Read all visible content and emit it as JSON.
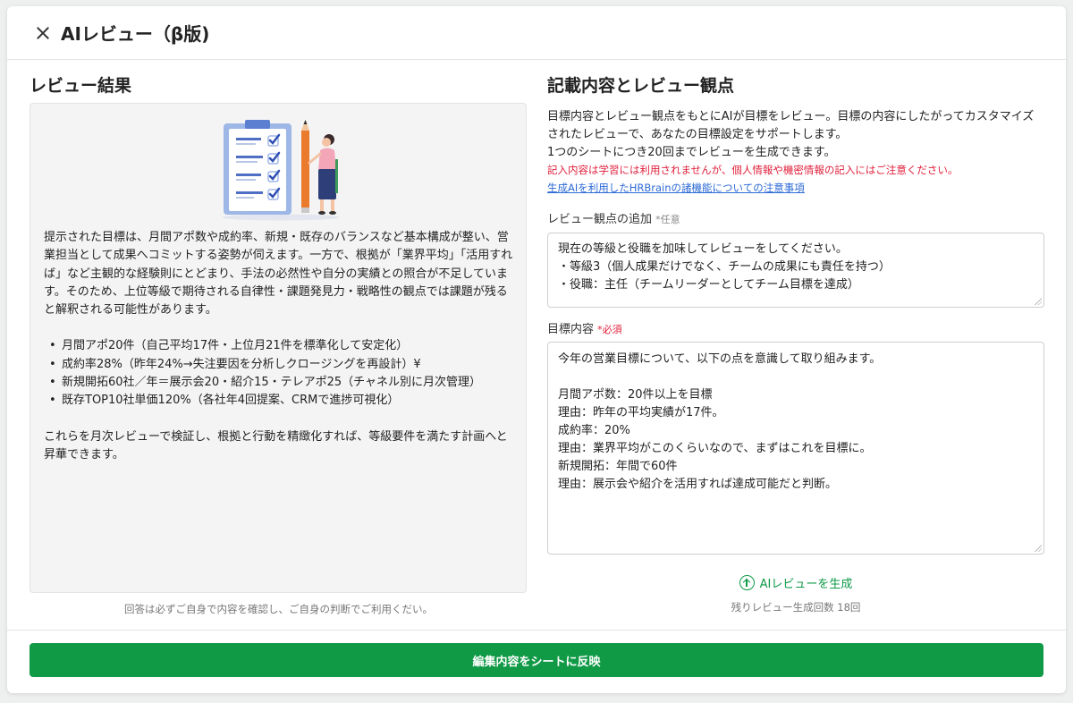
{
  "header": {
    "title": "AIレビュー（β版)"
  },
  "left": {
    "section_title": "レビュー結果",
    "paragraph1": "提示された目標は、月間アポ数や成約率、新規・既存のバランスなど基本構成が整い、営業担当として成果へコミットする姿勢が伺えます。一方で、根拠が「業界平均」「活用すれば」など主観的な経験則にとどまり、手法の必然性や自分の実績との照合が不足しています。そのため、上位等級で期待される自律性・課題発見力・戦略性の観点では課題が残ると解釈される可能性があります。",
    "bullets": [
      "月間アポ20件（自己平均17件・上位月21件を標準化して安定化）",
      "成約率28%（昨年24%→失注要因を分析しクロージングを再設計）¥",
      "新規開拓60社／年＝展示会20・紹介15・テレアポ25（チャネル別に月次管理）",
      "既存TOP10社単価120%（各社年4回提案、CRMで進捗可視化）"
    ],
    "paragraph2": "これらを月次レビューで検証し、根拠と行動を精緻化すれば、等級要件を満たす計画へと昇華できます。",
    "note": "回答は必ずご自身で内容を確認し、ご自身の判断でご利用くだい。"
  },
  "right": {
    "section_title": "記載内容とレビュー観点",
    "description": "目標内容とレビュー観点をもとにAIが目標をレビュー。目標の内容にしたがってカスタマイズされたレビューで、あなたの目標設定をサポートします。",
    "limit_text": "1つのシートにつき20回までレビューを生成できます。",
    "warning": "記入内容は学習には利用されませんが、個人情報や機密情報の記入にはご注意ください。",
    "link": "生成AIを利用したHRBrainの諸機能についての注意事項",
    "review_field": {
      "label": "レビュー観点の追加",
      "tag": "*任意",
      "value": "現在の等級と役職を加味してレビューをしてください。\n・等級3（個人成果だけでなく、チームの成果にも責任を持つ）\n・役職：主任（チームリーダーとしてチーム目標を達成）"
    },
    "goal_field": {
      "label": "目標内容",
      "tag": "*必須",
      "value": "今年の営業目標について、以下の点を意識して取り組みます。\n\n月間アポ数：20件以上を目標\n理由：昨年の平均実績が17件。\n成約率：20%\n理由：業界平均がこのくらいなので、まずはこれを目標に。\n新規開拓：年間で60件\n理由：展示会や紹介を活用すれば達成可能だと判断。"
    },
    "generate_label": "AIレビューを生成",
    "remaining": "残りレビュー生成回数 18回"
  },
  "footer": {
    "apply_label": "編集内容をシートに反映"
  },
  "colors": {
    "accent": "#109a46",
    "warning": "#e0203c",
    "link": "#2d6ad6"
  }
}
